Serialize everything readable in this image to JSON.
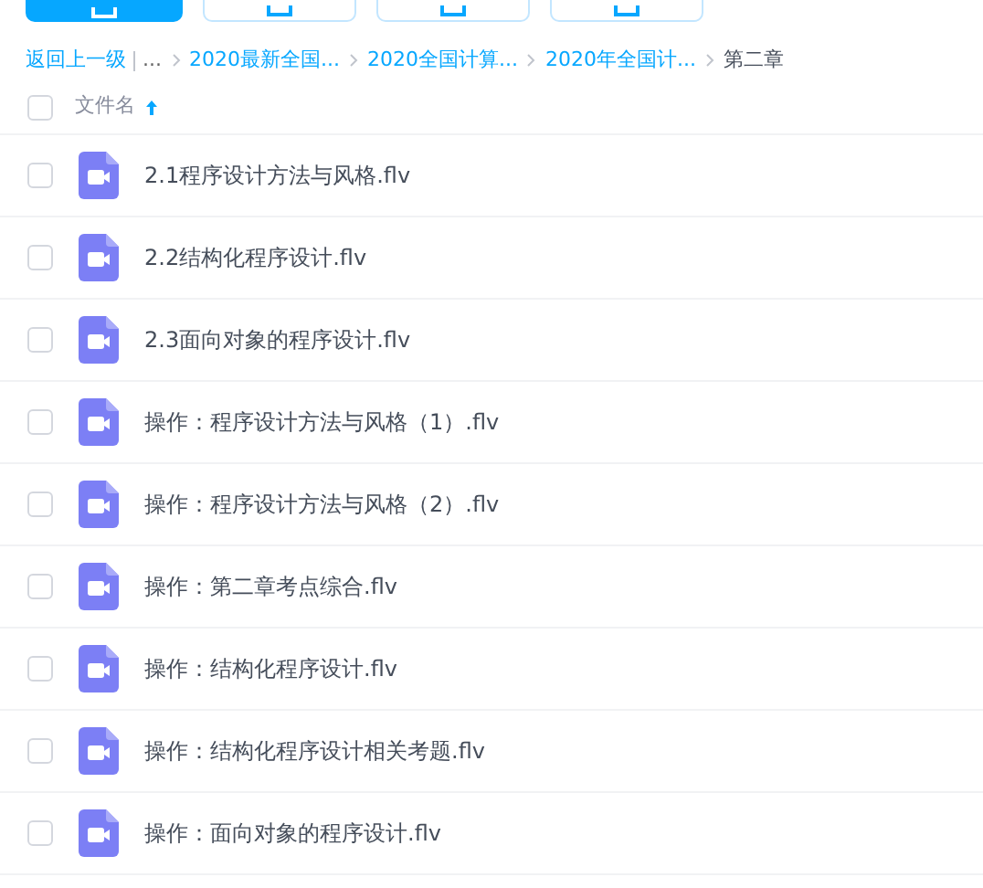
{
  "toolbar": {
    "buttons": [
      {
        "kind": "primary"
      },
      {
        "kind": "outline"
      },
      {
        "kind": "outline"
      },
      {
        "kind": "outline"
      }
    ]
  },
  "breadcrumb": {
    "back": "返回上一级",
    "ellipsis": "...",
    "items": [
      "2020最新全国...",
      "2020全国计算...",
      "2020年全国计..."
    ],
    "current": "第二章"
  },
  "header": {
    "checked": false,
    "column": "文件名",
    "sort_ascending": true
  },
  "files": [
    {
      "name": "2.1程序设计方法与风格.flv",
      "checked": false
    },
    {
      "name": "2.2结构化程序设计.flv",
      "checked": false
    },
    {
      "name": "2.3面向对象的程序设计.flv",
      "checked": false
    },
    {
      "name": "操作：程序设计方法与风格（1）.flv",
      "checked": false
    },
    {
      "name": "操作：程序设计方法与风格（2）.flv",
      "checked": false
    },
    {
      "name": "操作：第二章考点综合.flv",
      "checked": false
    },
    {
      "name": "操作：结构化程序设计.flv",
      "checked": false
    },
    {
      "name": "操作：结构化程序设计相关考题.flv",
      "checked": false
    },
    {
      "name": "操作：面向对象的程序设计.flv",
      "checked": false
    }
  ]
}
